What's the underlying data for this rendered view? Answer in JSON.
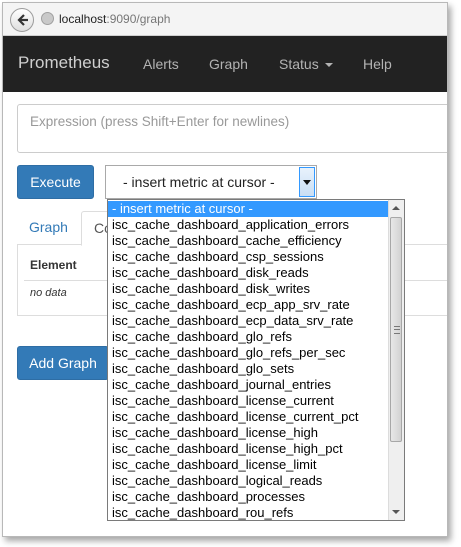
{
  "browser": {
    "url_host": "localhost",
    "url_rest": ":9090/graph"
  },
  "navbar": {
    "brand": "Prometheus",
    "items": [
      "Alerts",
      "Graph",
      "Status",
      "Help"
    ]
  },
  "expression": {
    "placeholder": "Expression (press Shift+Enter for newlines)"
  },
  "execute_label": "Execute",
  "metric_select": {
    "selected": "- insert metric at cursor -",
    "options": [
      "- insert metric at cursor -",
      "isc_cache_dashboard_application_errors",
      "isc_cache_dashboard_cache_efficiency",
      "isc_cache_dashboard_csp_sessions",
      "isc_cache_dashboard_disk_reads",
      "isc_cache_dashboard_disk_writes",
      "isc_cache_dashboard_ecp_app_srv_rate",
      "isc_cache_dashboard_ecp_data_srv_rate",
      "isc_cache_dashboard_glo_refs",
      "isc_cache_dashboard_glo_refs_per_sec",
      "isc_cache_dashboard_glo_sets",
      "isc_cache_dashboard_journal_entries",
      "isc_cache_dashboard_license_current",
      "isc_cache_dashboard_license_current_pct",
      "isc_cache_dashboard_license_high",
      "isc_cache_dashboard_license_high_pct",
      "isc_cache_dashboard_license_limit",
      "isc_cache_dashboard_logical_reads",
      "isc_cache_dashboard_processes",
      "isc_cache_dashboard_rou_refs"
    ]
  },
  "tabs": [
    "Graph",
    "Co"
  ],
  "table": {
    "header": "Element",
    "empty": "no data"
  },
  "add_graph_label": "Add Graph"
}
